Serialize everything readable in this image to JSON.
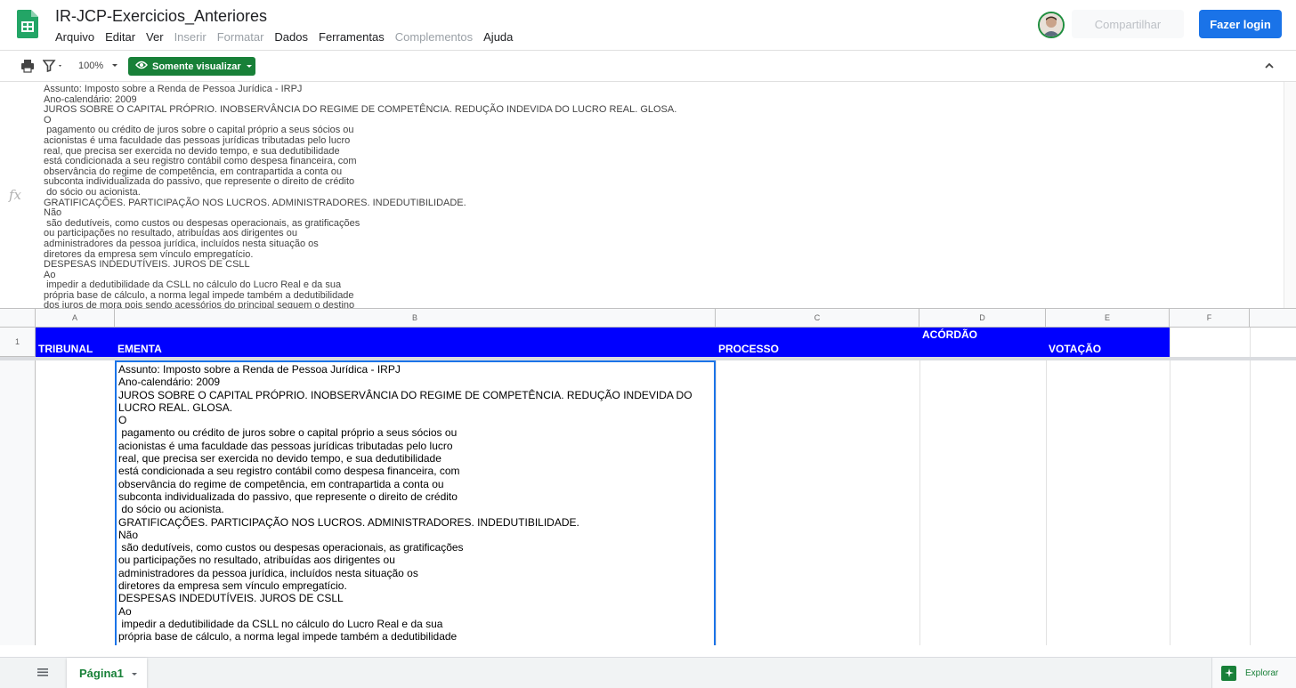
{
  "header": {
    "title": "IR-JCP-Exercicios_Anteriores",
    "menus": [
      {
        "label": "Arquivo",
        "enabled": true
      },
      {
        "label": "Editar",
        "enabled": true
      },
      {
        "label": "Ver",
        "enabled": true
      },
      {
        "label": "Inserir",
        "enabled": false
      },
      {
        "label": "Formatar",
        "enabled": false
      },
      {
        "label": "Dados",
        "enabled": true
      },
      {
        "label": "Ferramentas",
        "enabled": true
      },
      {
        "label": "Complementos",
        "enabled": false
      },
      {
        "label": "Ajuda",
        "enabled": true
      }
    ],
    "share_label": "Compartilhar",
    "login_label": "Fazer login"
  },
  "toolbar": {
    "zoom": "100%",
    "view_only_label": "Somente visualizar"
  },
  "formula_bar": {
    "text": "Assunto: Imposto sobre a Renda de Pessoa Jurídica - IRPJ\nAno-calendário: 2009\nJUROS SOBRE O CAPITAL PRÓPRIO. INOBSERVÂNCIA DO REGIME DE COMPETÊNCIA. REDUÇÃO INDEVIDA DO LUCRO REAL. GLOSA.\nO\n pagamento ou crédito de juros sobre o capital próprio a seus sócios ou\nacionistas é uma faculdade das pessoas jurídicas tributadas pelo lucro\nreal, que precisa ser exercida no devido tempo, e sua dedutibilidade\nestá condicionada a seu registro contábil como despesa financeira, com\nobservância do regime de competência, em contrapartida a conta ou\nsubconta individualizada do passivo, que represente o direito de crédito\n do sócio ou acionista.\nGRATIFICAÇÕES. PARTICIPAÇÃO NOS LUCROS. ADMINISTRADORES. INDEDUTIBILIDADE.\nNão\n são dedutíveis, como custos ou despesas operacionais, as gratificações\nou participações no resultado, atribuídas aos dirigentes ou\nadministradores da pessoa jurídica, incluídos nesta situação os\ndiretores da empresa sem vínculo empregatício.\nDESPESAS INDEDUTÍVEIS. JUROS DE CSLL\nAo\n impedir a dedutibilidade da CSLL no cálculo do Lucro Real e da sua\nprópria base de cálculo, a norma legal impede também a dedutibilidade\ndos juros de mora pois sendo acessórios do principal seguem o destino"
  },
  "grid": {
    "columns": [
      "A",
      "B",
      "C",
      "D",
      "E",
      "F"
    ],
    "rows": [
      "1"
    ],
    "headers": {
      "tribunal": "TRIBUNAL",
      "ementa": "EMENTA",
      "processo": "PROCESSO",
      "acordao": "ACÓRDÃO",
      "votacao": "VOTAÇÃO"
    },
    "cell_b2": "Assunto: Imposto sobre a Renda de Pessoa Jurídica - IRPJ\nAno-calendário: 2009\nJUROS SOBRE O CAPITAL PRÓPRIO. INOBSERVÂNCIA DO REGIME DE COMPETÊNCIA. REDUÇÃO INDEVIDA DO LUCRO REAL. GLOSA.\nO\n pagamento ou crédito de juros sobre o capital próprio a seus sócios ou\nacionistas é uma faculdade das pessoas jurídicas tributadas pelo lucro\nreal, que precisa ser exercida no devido tempo, e sua dedutibilidade\nestá condicionada a seu registro contábil como despesa financeira, com\nobservância do regime de competência, em contrapartida a conta ou\nsubconta individualizada do passivo, que represente o direito de crédito\n do sócio ou acionista.\nGRATIFICAÇÕES. PARTICIPAÇÃO NOS LUCROS. ADMINISTRADORES. INDEDUTIBILIDADE.\nNão\n são dedutíveis, como custos ou despesas operacionais, as gratificações\nou participações no resultado, atribuídas aos dirigentes ou\nadministradores da pessoa jurídica, incluídos nesta situação os\ndiretores da empresa sem vínculo empregatício.\nDESPESAS INDEDUTÍVEIS. JUROS DE CSLL\nAo\n impedir a dedutibilidade da CSLL no cálculo do Lucro Real e da sua\nprópria base de cálculo, a norma legal impede também a dedutibilidade"
  },
  "bottom": {
    "sheet_tab": "Página1",
    "explore_label": "Explorar"
  },
  "colors": {
    "header_fill": "#0000ff",
    "accent_green": "#188038",
    "login_blue": "#1a73e8"
  }
}
